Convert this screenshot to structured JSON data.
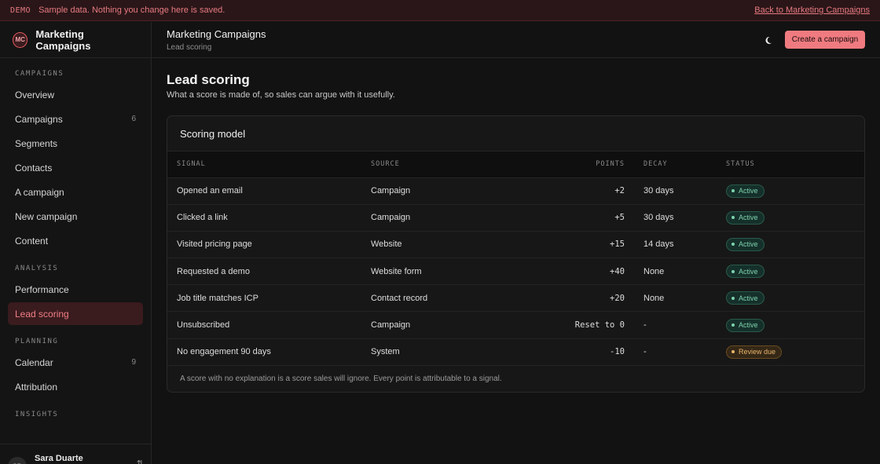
{
  "banner": {
    "tag": "DEMO",
    "message": "Sample data. Nothing you change here is saved.",
    "back_link": "Back to Marketing Campaigns"
  },
  "brand": {
    "initials": "MC",
    "name": "Marketing Campaigns"
  },
  "sidebar": {
    "sections": [
      {
        "label": "CAMPAIGNS",
        "items": [
          {
            "label": "Overview",
            "count": ""
          },
          {
            "label": "Campaigns",
            "count": "6"
          },
          {
            "label": "Segments",
            "count": ""
          },
          {
            "label": "Contacts",
            "count": ""
          },
          {
            "label": "A campaign",
            "count": ""
          },
          {
            "label": "New campaign",
            "count": ""
          },
          {
            "label": "Content",
            "count": ""
          }
        ]
      },
      {
        "label": "ANALYSIS",
        "items": [
          {
            "label": "Performance",
            "count": ""
          },
          {
            "label": "Lead scoring",
            "count": "",
            "active": true
          }
        ]
      },
      {
        "label": "PLANNING",
        "items": [
          {
            "label": "Calendar",
            "count": "9"
          },
          {
            "label": "Attribution",
            "count": ""
          }
        ]
      },
      {
        "label": "INSIGHTS",
        "items": []
      }
    ],
    "user": {
      "initials": "SD",
      "name": "Sara Duarte",
      "icon": "switch-icon"
    }
  },
  "header": {
    "title": "Marketing Campaigns",
    "breadcrumb": "Lead scoring",
    "theme_icon": "moon-icon",
    "cta_label": "Create a campaign"
  },
  "page": {
    "title": "Lead scoring",
    "subtitle": "What a score is made of, so sales can argue with it usefully."
  },
  "scoring": {
    "title": "Scoring model",
    "columns": [
      "SIGNAL",
      "SOURCE",
      "POINTS",
      "DECAY",
      "STATUS"
    ],
    "rows": [
      {
        "signal": "Opened an email",
        "source": "Campaign",
        "points": "+2",
        "decay": "30 days",
        "status": "Active",
        "status_kind": "ok"
      },
      {
        "signal": "Clicked a link",
        "source": "Campaign",
        "points": "+5",
        "decay": "30 days",
        "status": "Active",
        "status_kind": "ok"
      },
      {
        "signal": "Visited pricing page",
        "source": "Website",
        "points": "+15",
        "decay": "14 days",
        "status": "Active",
        "status_kind": "ok"
      },
      {
        "signal": "Requested a demo",
        "source": "Website form",
        "points": "+40",
        "decay": "None",
        "status": "Active",
        "status_kind": "ok"
      },
      {
        "signal": "Job title matches ICP",
        "source": "Contact record",
        "points": "+20",
        "decay": "None",
        "status": "Active",
        "status_kind": "ok"
      },
      {
        "signal": "Unsubscribed",
        "source": "Campaign",
        "points": "Reset to 0",
        "decay": "-",
        "status": "Active",
        "status_kind": "ok"
      },
      {
        "signal": "No engagement 90 days",
        "source": "System",
        "points": "-10",
        "decay": "-",
        "status": "Review due",
        "status_kind": "warn"
      }
    ],
    "footnote": "A score with no explanation is a score sales will ignore. Every point is attributable to a signal."
  },
  "colors": {
    "accent": "#ef7b80",
    "active_nav_bg": "#3a1b1e",
    "status_ok": "#7ed3ae",
    "status_warn": "#e9b46a"
  }
}
